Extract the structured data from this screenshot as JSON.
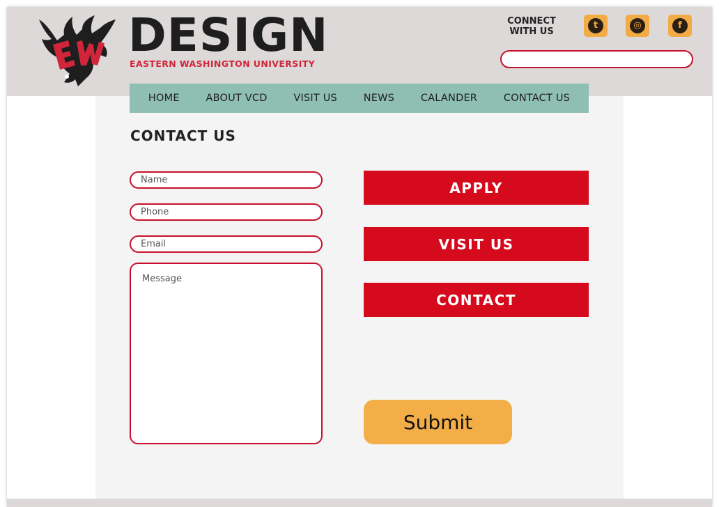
{
  "brand": {
    "title": "DESIGN",
    "subtitle": "EASTERN WASHINGTON UNIVERSITY",
    "logo_icon": "eagle-ew-logo",
    "accent_color": "#c8102e",
    "nav_color": "#8fbfb2",
    "cta_color": "#d50a1c",
    "submit_color": "#f4ae47"
  },
  "header": {
    "connect_line1": "CONNECT",
    "connect_line2": "WITH US",
    "social": [
      {
        "icon": "twitter-icon",
        "glyph": "t"
      },
      {
        "icon": "instagram-icon",
        "glyph": "◎"
      },
      {
        "icon": "facebook-icon",
        "glyph": "f"
      }
    ],
    "search_value": ""
  },
  "nav": {
    "items": [
      "HOME",
      "ABOUT VCD",
      "VISIT US",
      "NEWS",
      "CALANDER",
      "CONTACT US"
    ]
  },
  "main": {
    "title": "CONTACT US",
    "form": {
      "name_placeholder": "Name",
      "phone_placeholder": "Phone",
      "email_placeholder": "Email",
      "message_placeholder": "Message",
      "submit_label": "Submit"
    },
    "buttons": [
      "APPLY",
      "VISIT US",
      "CONTACT"
    ]
  }
}
